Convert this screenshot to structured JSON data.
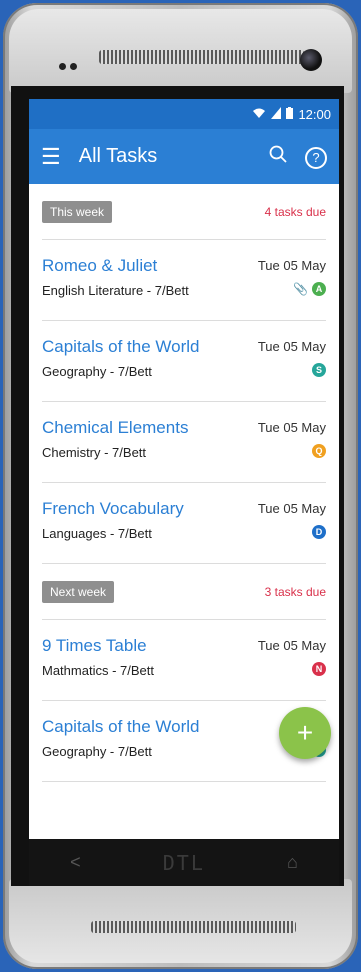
{
  "status": {
    "time": "12:00",
    "wifi_icon": "wifi-icon",
    "signal_icon": "signal-icon",
    "battery_icon": "battery-icon"
  },
  "appbar": {
    "title": "All Tasks",
    "menu_icon": "menu-icon",
    "search_icon": "search-icon",
    "help_icon": "help-icon",
    "help_glyph": "?"
  },
  "sections": [
    {
      "label": "This week",
      "due": "4 tasks due"
    },
    {
      "label": "Next week",
      "due": "3 tasks due"
    }
  ],
  "tasks_this_week": [
    {
      "name": "Romeo & Juliet",
      "course": "English Literature - 7/Bett",
      "date": "Tue 05 May",
      "badge": "A",
      "badge_color": "#4caf50",
      "attachment": true
    },
    {
      "name": "Capitals of the World",
      "course": "Geography - 7/Bett",
      "date": "Tue 05 May",
      "badge": "S",
      "badge_color": "#26a69a"
    },
    {
      "name": "Chemical Elements",
      "course": "Chemistry - 7/Bett",
      "date": "Tue 05 May",
      "badge": "Q",
      "badge_color": "#f0a020"
    },
    {
      "name": "French Vocabulary",
      "course": "Languages - 7/Bett",
      "date": "Tue 05 May",
      "badge": "D",
      "badge_color": "#1e6fc9"
    }
  ],
  "tasks_next_week": [
    {
      "name": "9 Times Table",
      "course": "Mathmatics - 7/Bett",
      "date": "Tue 05 May",
      "badge": "N",
      "badge_color": "#d9314b"
    },
    {
      "name": "Capitals of the World",
      "course": "Geography - 7/Bett",
      "date": "Tu",
      "badge": "S",
      "badge_color": "#26a69a"
    }
  ],
  "fab": {
    "label": "+"
  },
  "navbar": {
    "back": "<",
    "logo": "DTL",
    "home": "⌂"
  }
}
